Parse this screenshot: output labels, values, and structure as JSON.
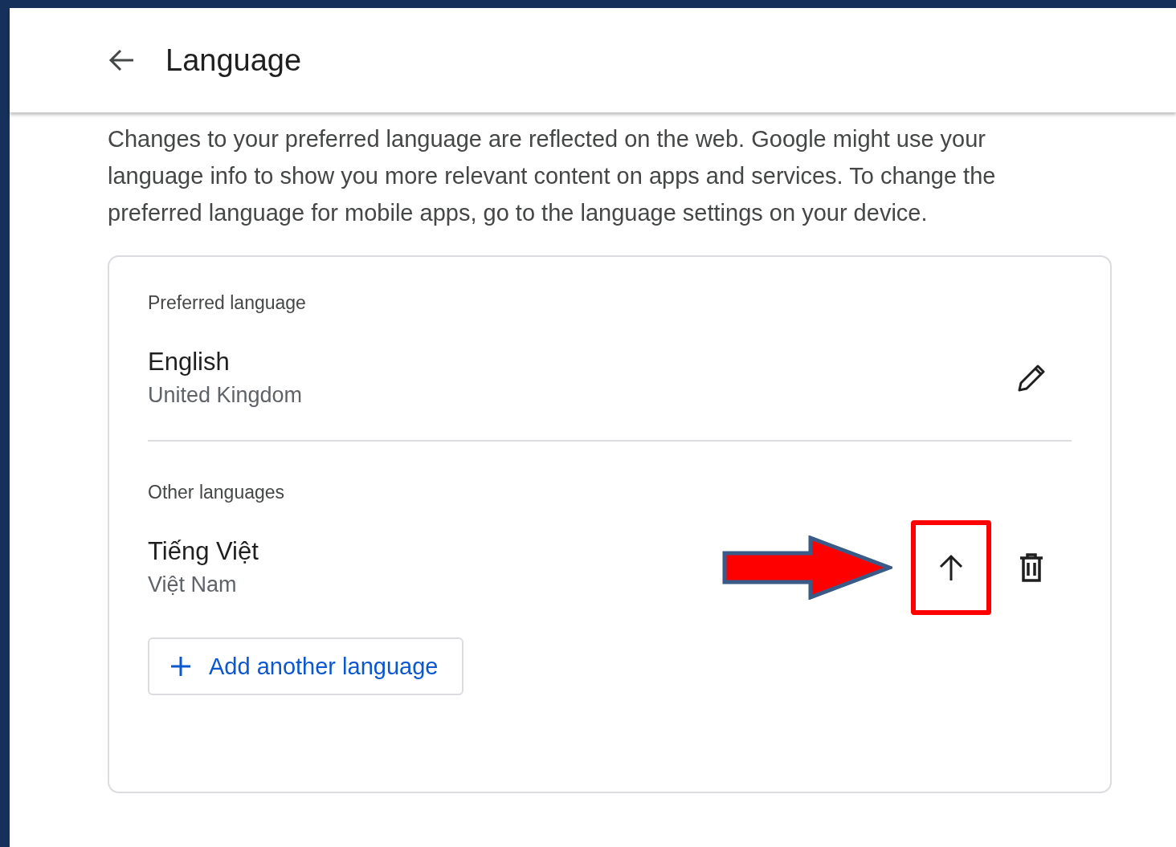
{
  "header": {
    "title": "Language"
  },
  "description": "Changes to your preferred language are reflected on the web. Google might use your language info to show you more relevant content on apps and services. To change the preferred language for mobile apps, go to the language settings on your device.",
  "sections": [
    {
      "label": "Preferred language",
      "languages": [
        {
          "name": "English",
          "region": "United Kingdom",
          "actions": [
            {
              "kind": "edit",
              "highlighted": false
            }
          ]
        }
      ]
    },
    {
      "label": "Other languages",
      "languages": [
        {
          "name": "Tiếng Việt",
          "region": "Việt Nam",
          "actions": [
            {
              "kind": "move_up",
              "highlighted": true
            },
            {
              "kind": "delete",
              "highlighted": false
            }
          ]
        }
      ]
    }
  ],
  "add_button": {
    "label": "Add another language"
  }
}
